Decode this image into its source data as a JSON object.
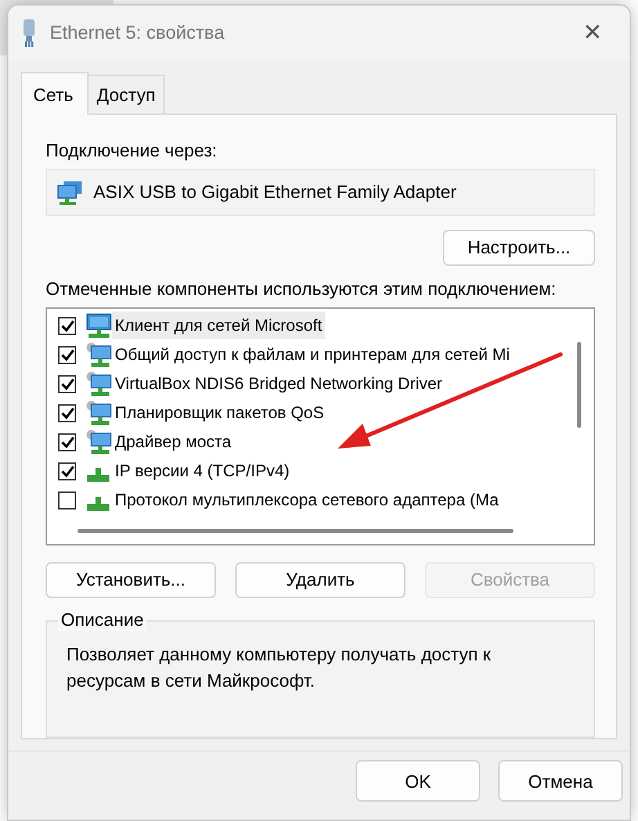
{
  "window": {
    "title": "Ethernet 5: свойства",
    "close": "✕"
  },
  "tabs": [
    {
      "label": "Сеть",
      "selected": true
    },
    {
      "label": "Доступ",
      "selected": false
    }
  ],
  "connect_via": {
    "label": "Подключение через:",
    "adapter": "ASIX USB to Gigabit Ethernet Family Adapter"
  },
  "configure_button": "Настроить...",
  "components_label": "Отмеченные компоненты используются этим подключением:",
  "components": [
    {
      "name": "Клиент для сетей Microsoft",
      "kind": "client",
      "checked": true,
      "selected": true
    },
    {
      "name": "Общий доступ к файлам и принтерам для сетей Mi",
      "kind": "service",
      "checked": true,
      "selected": false
    },
    {
      "name": "VirtualBox NDIS6 Bridged Networking Driver",
      "kind": "service",
      "checked": true,
      "selected": false
    },
    {
      "name": "Планировщик пакетов QoS",
      "kind": "service",
      "checked": true,
      "selected": false
    },
    {
      "name": "Драйвер моста",
      "kind": "service",
      "checked": true,
      "selected": false
    },
    {
      "name": "IP версии 4 (TCP/IPv4)",
      "kind": "protocol",
      "checked": true,
      "selected": false
    },
    {
      "name": "Протокол мультиплексора сетевого адаптера (Ма",
      "kind": "protocol",
      "checked": false,
      "selected": false
    }
  ],
  "buttons": [
    {
      "label": "Установить...",
      "disabled": false
    },
    {
      "label": "Удалить",
      "disabled": false
    },
    {
      "label": "Свойства",
      "disabled": true
    }
  ],
  "description": {
    "title": "Описание",
    "text": "Позволяет данному компьютеру получать доступ к ресурсам в сети Майкрософт."
  },
  "footer_buttons": [
    {
      "label": "OK"
    },
    {
      "label": "Отмена"
    }
  ]
}
